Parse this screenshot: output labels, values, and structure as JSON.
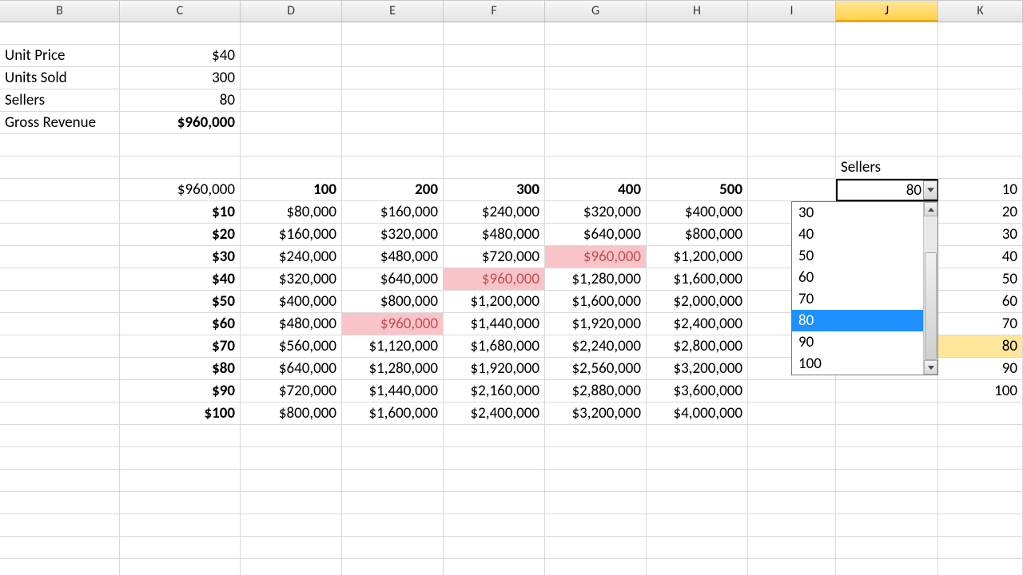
{
  "columns": [
    "B",
    "C",
    "D",
    "E",
    "F",
    "G",
    "H",
    "I",
    "J",
    "K"
  ],
  "active_column_index": 8,
  "col_widths": [
    "wB",
    "wC",
    "wD",
    "wE",
    "wF",
    "wG",
    "wH",
    "wI",
    "wJ",
    "wK"
  ],
  "params": {
    "unit_price_label": "Unit Price",
    "unit_price_value": "$40",
    "units_sold_label": "Units Sold",
    "units_sold_value": "300",
    "sellers_label": "Sellers",
    "sellers_value": "80",
    "gross_rev_label": "Gross Revenue",
    "gross_rev_value": "$960,000"
  },
  "table": {
    "corner": "$960,000",
    "col_heads": [
      "100",
      "200",
      "300",
      "400",
      "500"
    ],
    "row_heads": [
      "$10",
      "$20",
      "$30",
      "$40",
      "$50",
      "$60",
      "$70",
      "$80",
      "$90",
      "$100"
    ],
    "body": [
      [
        "$80,000",
        "$160,000",
        "$240,000",
        "$320,000",
        "$400,000"
      ],
      [
        "$160,000",
        "$320,000",
        "$480,000",
        "$640,000",
        "$800,000"
      ],
      [
        "$240,000",
        "$480,000",
        "$720,000",
        "$960,000",
        "$1,200,000"
      ],
      [
        "$320,000",
        "$640,000",
        "$960,000",
        "$1,280,000",
        "$1,600,000"
      ],
      [
        "$400,000",
        "$800,000",
        "$1,200,000",
        "$1,600,000",
        "$2,000,000"
      ],
      [
        "$480,000",
        "$960,000",
        "$1,440,000",
        "$1,920,000",
        "$2,400,000"
      ],
      [
        "$560,000",
        "$1,120,000",
        "$1,680,000",
        "$2,240,000",
        "$2,800,000"
      ],
      [
        "$640,000",
        "$1,280,000",
        "$1,920,000",
        "$2,560,000",
        "$3,200,000"
      ],
      [
        "$720,000",
        "$1,440,000",
        "$2,160,000",
        "$2,880,000",
        "$3,600,000"
      ],
      [
        "$800,000",
        "$1,600,000",
        "$2,400,000",
        "$3,200,000",
        "$4,000,000"
      ]
    ],
    "highlight_cells": [
      {
        "r": 2,
        "c": 3
      },
      {
        "r": 3,
        "c": 2
      },
      {
        "r": 5,
        "c": 1
      }
    ]
  },
  "sellers_dd": {
    "label": "Sellers",
    "value": "80",
    "options": [
      "30",
      "40",
      "50",
      "60",
      "70",
      "80",
      "90",
      "100"
    ],
    "selected_index": 5
  },
  "k_list": [
    "10",
    "20",
    "30",
    "40",
    "50",
    "60",
    "70",
    "80",
    "90",
    "100"
  ],
  "k_highlight_index": 7
}
